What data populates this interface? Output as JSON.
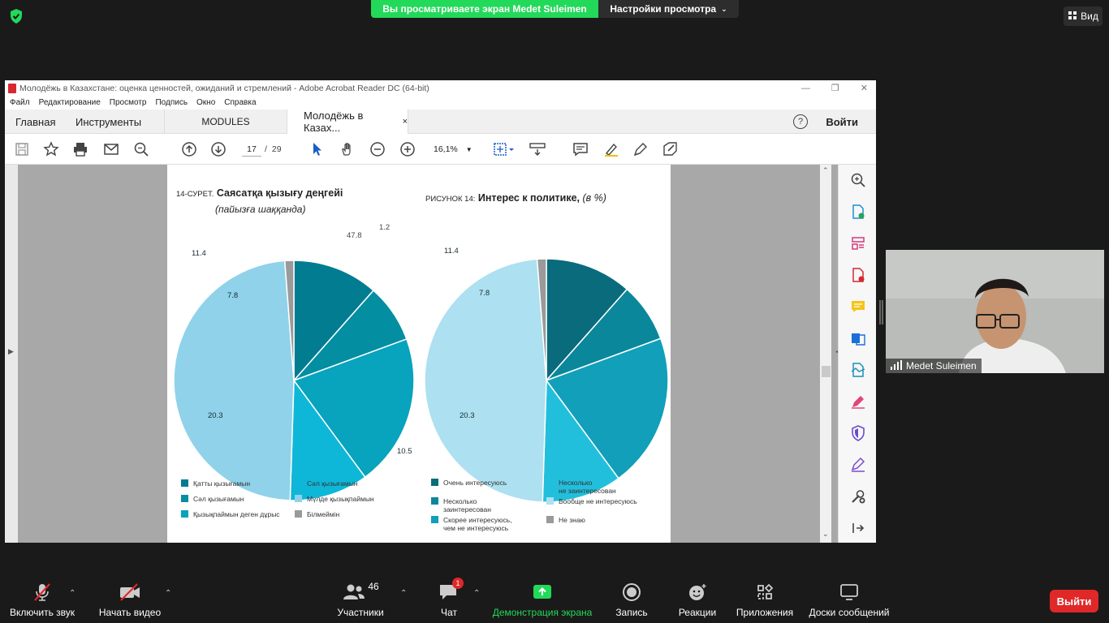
{
  "zoom_top": {
    "sharing_banner": "Вы просматриваете экран Medet Suleimen",
    "view_options": "Настройки просмотра",
    "view_button": "Вид"
  },
  "acrobat": {
    "window_title": "Молодёжь в Казахстане: оценка ценностей, ожиданий и стремлений - Adobe Acrobat Reader DC (64-bit)",
    "menu": [
      "Файл",
      "Редактирование",
      "Просмотр",
      "Подпись",
      "Окно",
      "Справка"
    ],
    "tabs": {
      "home": "Главная",
      "tools": "Инструменты",
      "modules": "MODULES",
      "document": "Молодёжь в Казах...",
      "close": "×"
    },
    "help": "?",
    "sign_in": "Войти",
    "page_current": "17",
    "page_total": "29",
    "zoom_level": "16,1%"
  },
  "chart_data": [
    {
      "type": "pie",
      "title_prefix": "14-СУРЕТ.",
      "title": "Саясатқа қызығу деңгейі",
      "subtitle": "(пайызға шаққанда)",
      "categories": [
        "Қатты қызығамын",
        "Сәл қызығамын",
        "Қызықпаймын деген дұрыс",
        "Сәл қызығамын",
        "Мүлде қызықпаймын",
        "Білмеймін"
      ],
      "values": [
        11.4,
        7.8,
        20.3,
        10.5,
        47.8,
        1.2
      ],
      "labels": [
        "11.4",
        "7.8",
        "20.3",
        "10.5",
        "47.8",
        "1.2"
      ],
      "colors": [
        "#017c91",
        "#048ea1",
        "#08a3bd",
        "#0eb7d8",
        "#8fd2ea",
        "#9a9a9a"
      ]
    },
    {
      "type": "pie",
      "title_prefix": "РИСУНОК 14:",
      "title": "Интерес к политике,",
      "subtitle": "(в %)",
      "categories": [
        "Очень интересуюсь",
        "Несколько заинтересован",
        "Скорее интересуюсь, чем не интересуюсь",
        "Несколько не заинтересован",
        "Вообще не интересуюсь",
        "Не знаю"
      ],
      "values": [
        11.4,
        7.8,
        20.3,
        10.5,
        47.8,
        1.2
      ],
      "labels": [
        "11.4",
        "7.8",
        "20.3",
        "10.5",
        "47.8",
        "1.2"
      ],
      "colors": [
        "#0a6b7d",
        "#0b879b",
        "#119fba",
        "#22bfdc",
        "#ade0f0",
        "#9a9a9a"
      ]
    }
  ],
  "legend_kz": [
    "Қатты қызығамын",
    "Сәл қызығамын",
    "Сәл қызығамын",
    "Мүлде қызықпаймын",
    "Қызықпаймын деген дұрыс",
    "Білмеймін"
  ],
  "legend_ru": [
    "Очень интересуюсь",
    "Несколько\nне заинтересован",
    "Несколько\nзаинтересован",
    "Вообще не интересуюсь",
    "Скорее интересуюсь,\nчем не интересуюсь",
    "Не знаю"
  ],
  "webcam": {
    "name": "Medet Suleimen"
  },
  "bottom": {
    "unmute": "Включить звук",
    "start_video": "Начать видео",
    "participants": "Участники",
    "participants_count": "46",
    "chat": "Чат",
    "chat_badge": "1",
    "share": "Демонстрация экрана",
    "record": "Запись",
    "reactions": "Реакции",
    "apps": "Приложения",
    "whiteboards": "Доски сообщений",
    "leave": "Выйти"
  },
  "colors": {
    "zoom_green": "#23d959",
    "leave_red": "#e02828",
    "share_green": "#23d959"
  }
}
